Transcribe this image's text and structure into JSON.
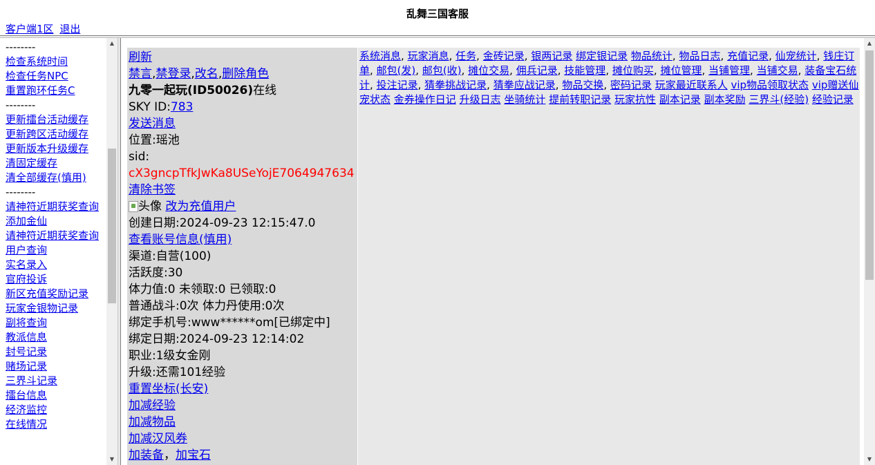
{
  "header": {
    "title": "乱舞三国客服",
    "server_link": "客户端1区",
    "logout_link": "退出"
  },
  "sidebar": {
    "items": [
      {
        "label": "--------",
        "type": "separator"
      },
      {
        "label": "检查系统时间",
        "type": "link"
      },
      {
        "label": "检查任务NPC",
        "type": "link"
      },
      {
        "label": "重置跑环任务C",
        "type": "link"
      },
      {
        "label": "--------",
        "type": "separator"
      },
      {
        "label": "更新擂台活动缓存",
        "type": "link"
      },
      {
        "label": "更新跨区活动缓存",
        "type": "link"
      },
      {
        "label": "更新版本升级缓存",
        "type": "link"
      },
      {
        "label": "清固定缓存",
        "type": "link"
      },
      {
        "label": "清全部缓存(慎用)",
        "type": "link"
      },
      {
        "label": "--------",
        "type": "separator"
      },
      {
        "label": "请神符近期获奖查询",
        "type": "link"
      },
      {
        "label": "添加金仙",
        "type": "link"
      },
      {
        "label": "请神符近期获奖查询",
        "type": "link"
      },
      {
        "label": "用户查询",
        "type": "link"
      },
      {
        "label": "实名录入",
        "type": "link"
      },
      {
        "label": "官府投诉",
        "type": "link"
      },
      {
        "label": "新区充值奖励记录",
        "type": "link"
      },
      {
        "label": "玩家金银物记录",
        "type": "link"
      },
      {
        "label": "副将查询",
        "type": "link"
      },
      {
        "label": "教派信息",
        "type": "link"
      },
      {
        "label": "封号记录",
        "type": "link"
      },
      {
        "label": "赌场记录",
        "type": "link"
      },
      {
        "label": "三界斗记录",
        "type": "link"
      },
      {
        "label": "擂台信息",
        "type": "link"
      },
      {
        "label": "经济监控",
        "type": "link"
      },
      {
        "label": "在线情况",
        "type": "link"
      }
    ]
  },
  "player": {
    "refresh": "刷新",
    "actions": [
      "禁言",
      "禁登录",
      "改名",
      "删除角色"
    ],
    "action_sep": ",",
    "name": "九零一起玩(ID50026)",
    "online_status": "在线",
    "sky_id_label": "SKY ID:",
    "sky_id": "783",
    "send_message": "发送消息",
    "location": "位置:瑶池",
    "sid_label": "sid:",
    "sid_value": "cX3gncpTfkJwKa8USeYojE7064947634",
    "clear_bookmark": "清除书签",
    "avatar_alt": "头像",
    "change_to_recharge_user": "改为充值用户",
    "created": "创建日期:2024-09-23 12:15:47.0",
    "view_account": "查看账号信息(慎用)",
    "channel": "渠道:自营(100)",
    "activity": "活跃度:30",
    "stamina": "体力值:0 未领取:0 已领取:0",
    "battles": "普通战斗:0次 体力丹使用:0次",
    "bound_phone": "绑定手机号:www******om[已绑定中]",
    "bound_date": "绑定日期:2024-09-23 12:14:02",
    "profession": "职业:1级女金刚",
    "upgrade": "升级:还需101经验",
    "reset_coords": "重置坐标(长安)",
    "adjust_exp": "加减经验",
    "adjust_items": "加减物品",
    "adjust_coupons": "加减汉风券",
    "add_equipment": "加装备",
    "equip_sep": "，",
    "add_gem": "加宝石"
  },
  "records": {
    "links": [
      {
        "label": "系统消息",
        "sep": ","
      },
      {
        "label": "玩家消息",
        "sep": ","
      },
      {
        "label": "任务",
        "sep": ","
      },
      {
        "label": "金砖记录",
        "sep": ","
      },
      {
        "label": "银两记录",
        "sep": ""
      },
      {
        "label": "绑定银记录",
        "sep": ""
      },
      {
        "label": "物品统计",
        "sep": ","
      },
      {
        "label": "物品日志",
        "sep": ","
      },
      {
        "label": "充值记录",
        "sep": ","
      },
      {
        "label": "仙宠统计",
        "sep": ","
      },
      {
        "label": "钱庄订单",
        "sep": ","
      },
      {
        "label": "邮包(发)",
        "sep": ","
      },
      {
        "label": "邮包(收)",
        "sep": ","
      },
      {
        "label": "摊位交易",
        "sep": ","
      },
      {
        "label": "佣兵记录",
        "sep": ","
      },
      {
        "label": "技能管理",
        "sep": ","
      },
      {
        "label": "摊位购买",
        "sep": ","
      },
      {
        "label": "摊位管理",
        "sep": ","
      },
      {
        "label": "当铺管理",
        "sep": ","
      },
      {
        "label": "当铺交易",
        "sep": ","
      },
      {
        "label": "装备宝石统计",
        "sep": ","
      },
      {
        "label": "投注记录",
        "sep": ","
      },
      {
        "label": "猜拳挑战记录",
        "sep": ","
      },
      {
        "label": "猜拳应战记录",
        "sep": ","
      },
      {
        "label": "物品交换",
        "sep": ","
      },
      {
        "label": "密码记录",
        "sep": ""
      },
      {
        "label": "玩家最近联系人",
        "sep": ""
      },
      {
        "label": "vip物品领取状态",
        "sep": ""
      },
      {
        "label": "vip赠送仙宠状态",
        "sep": ""
      },
      {
        "label": "金券操作日记",
        "sep": ""
      },
      {
        "label": "升级日志",
        "sep": ""
      },
      {
        "label": "坐骑统计",
        "sep": ""
      },
      {
        "label": "提前转职记录",
        "sep": ""
      },
      {
        "label": "玩家抗性",
        "sep": ""
      },
      {
        "label": "副本记录",
        "sep": ""
      },
      {
        "label": "副本奖励",
        "sep": ""
      },
      {
        "label": "三界斗(经验)",
        "sep": ""
      },
      {
        "label": "经验记录",
        "sep": ""
      }
    ]
  },
  "colors": {
    "link": "#0000ee",
    "sid": "#ff0000",
    "info_panel_bg": "#d9d9d9",
    "records_panel_bg": "#e8e8e8"
  }
}
